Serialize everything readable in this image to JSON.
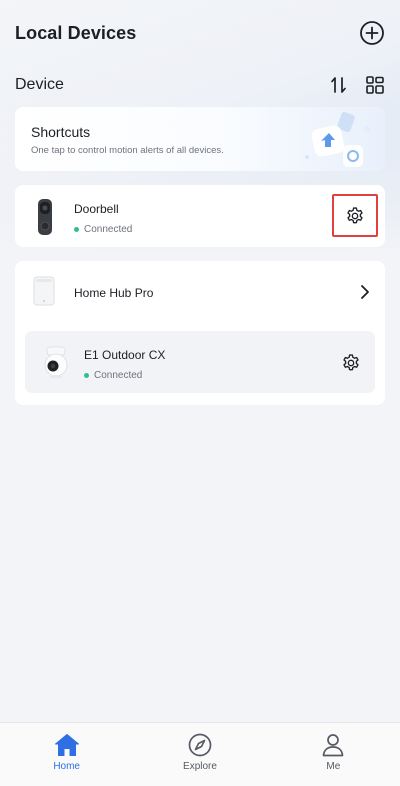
{
  "header": {
    "title": "Local Devices",
    "add_icon": "plus-circle-icon"
  },
  "section": {
    "title": "Device",
    "sort_icon": "sort-icon",
    "layout_icon": "grid-layout-icon"
  },
  "shortcuts": {
    "title": "Shortcuts",
    "subtitle": "One tap to control motion alerts of all devices."
  },
  "devices": [
    {
      "name": "Doorbell",
      "status": "Connected",
      "action_icon": "gear-icon"
    },
    {
      "name": "Home Hub Pro",
      "action_icon": "chevron-right-icon"
    },
    {
      "name": "E1 Outdoor CX",
      "status": "Connected",
      "action_icon": "gear-icon"
    }
  ],
  "tabs": [
    {
      "label": "Home",
      "icon": "home-icon",
      "active": true
    },
    {
      "label": "Explore",
      "icon": "compass-icon",
      "active": false
    },
    {
      "label": "Me",
      "icon": "person-icon",
      "active": false
    }
  ],
  "colors": {
    "accent": "#2f6fe4",
    "status_connected": "#2fbf8a",
    "highlight": "#e0413f"
  }
}
